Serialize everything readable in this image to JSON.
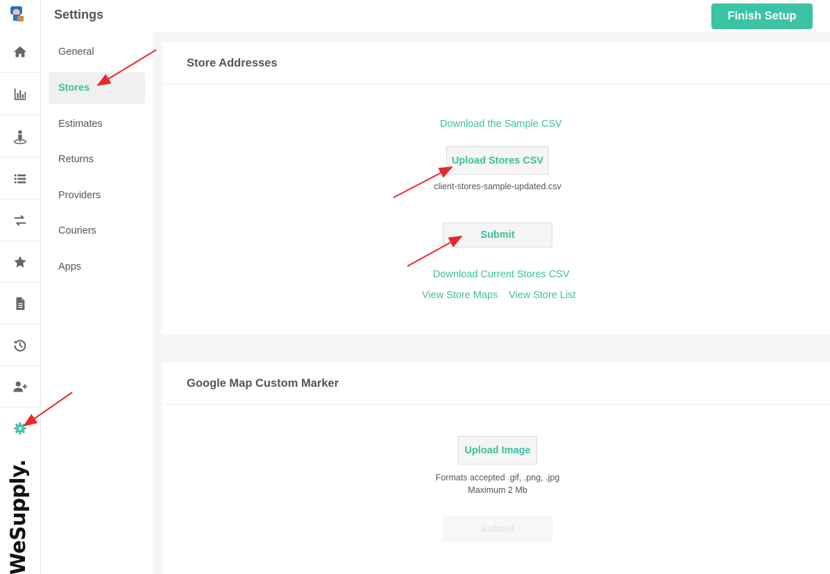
{
  "settings_menu": {
    "title": "Settings",
    "items": [
      {
        "label": "General",
        "active": false
      },
      {
        "label": "Stores",
        "active": true
      },
      {
        "label": "Estimates",
        "active": false
      },
      {
        "label": "Returns",
        "active": false
      },
      {
        "label": "Providers",
        "active": false
      },
      {
        "label": "Couriers",
        "active": false
      },
      {
        "label": "Apps",
        "active": false
      }
    ]
  },
  "sidebar": {
    "icons": [
      "home-icon",
      "bar-chart-icon",
      "street-view-icon",
      "list-icon",
      "exchange-icon",
      "star-icon",
      "document-icon",
      "history-icon",
      "user-plus-icon",
      "gear-icon"
    ],
    "active_icon": "gear-icon",
    "brand": "WeSupply."
  },
  "topbar": {
    "finish_label": "Finish Setup"
  },
  "store_addresses": {
    "title": "Store Addresses",
    "download_sample": "Download the Sample CSV",
    "upload_label": "Upload Stores CSV",
    "selected_file": "client-stores-sample-updated.csv",
    "submit_label": "Submit",
    "download_current": "Download Current Stores CSV",
    "view_maps": "View Store Maps",
    "view_list": "View Store List"
  },
  "marker": {
    "title": "Google Map Custom Marker",
    "upload_label": "Upload Image",
    "formats": "Formats accepted .gif, .png, .jpg",
    "max_size": "Maximum 2 Mb",
    "submit_label": "Submit"
  },
  "colors": {
    "accent": "#3cc3a3",
    "annotation_arrow": "#e8282b"
  }
}
